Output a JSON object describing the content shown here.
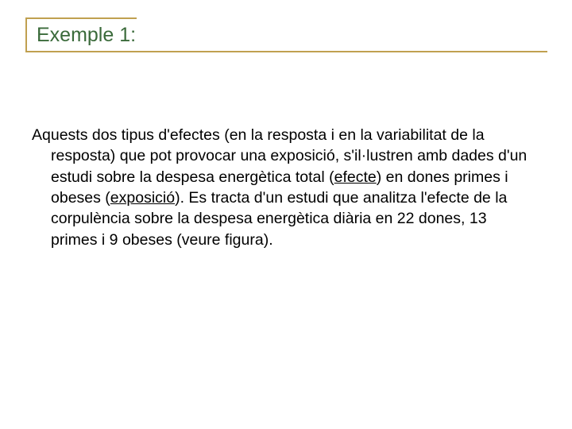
{
  "title": "Exemple 1:",
  "paragraph": {
    "p1": "Aquests dos tipus d'efectes (en la resposta i en la variabilitat de la resposta) que pot provocar una exposició, s'il·lustren amb dades d'un estudi sobre la despesa energètica total (",
    "u1": "efecte",
    "p2": ") en dones primes i obeses (",
    "u2": "exposició",
    "p3": "). Es  tracta d'un estudi que analitza l'efecte de la corpulència sobre la despesa energètica diària en 22 dones, 13 primes i 9 obeses (veure figura)."
  }
}
